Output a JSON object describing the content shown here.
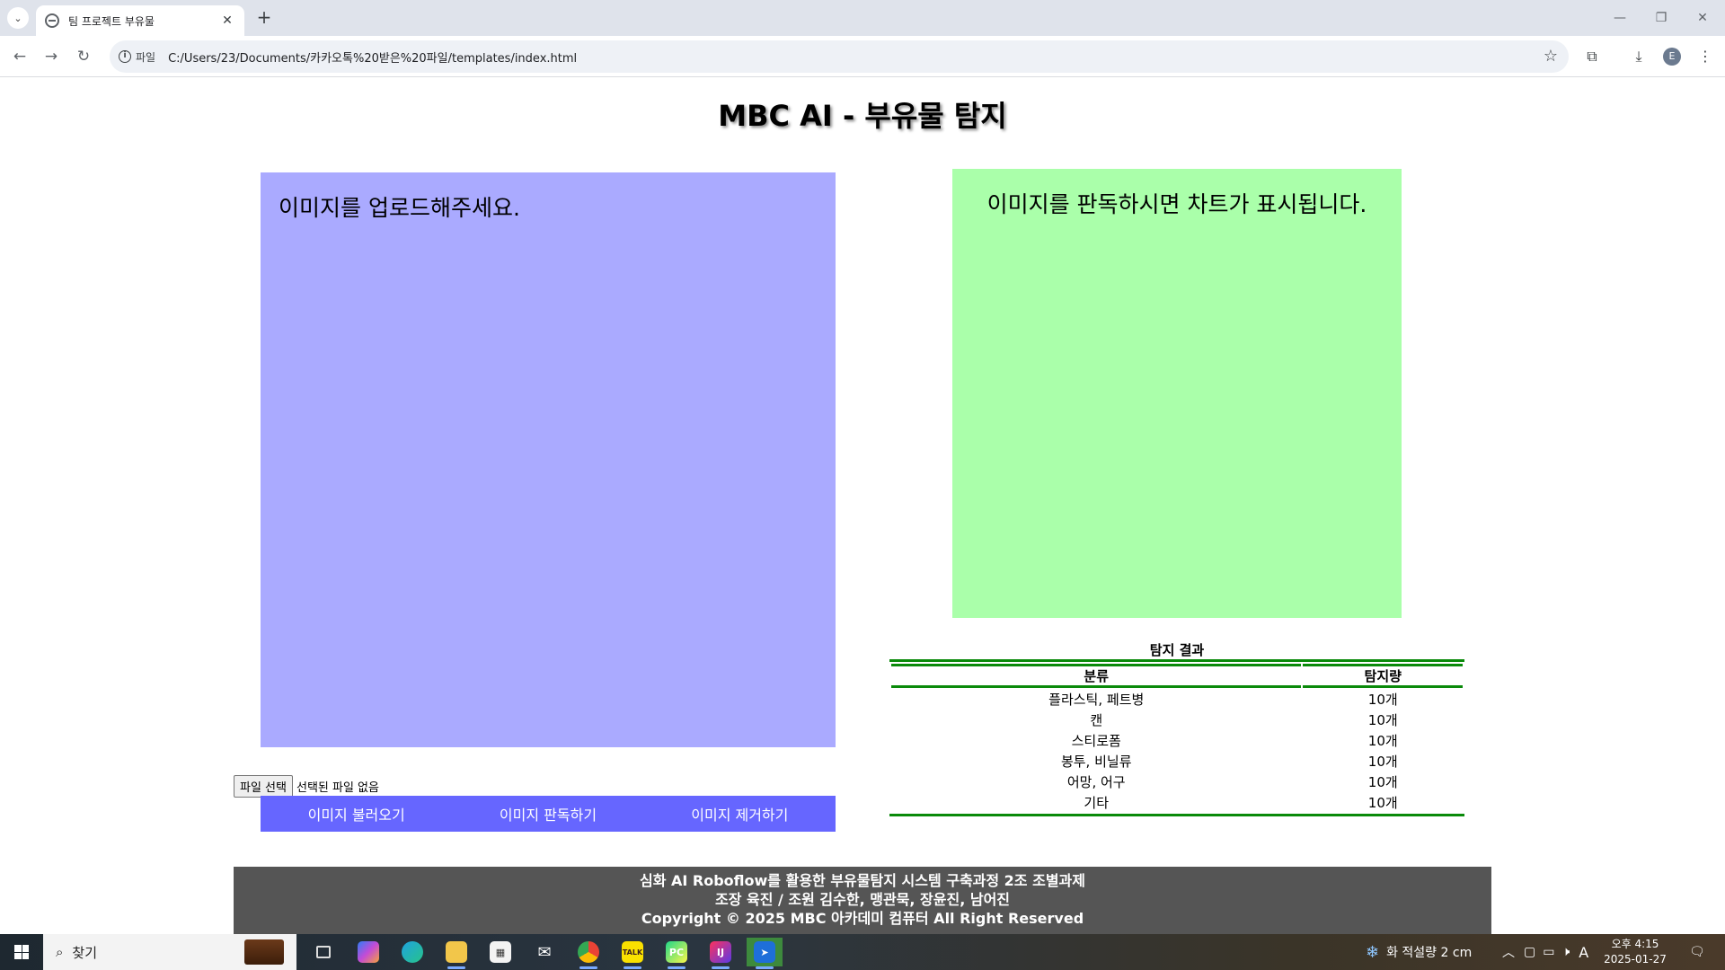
{
  "browser": {
    "tab_title": "팀 프로젝트 부유물",
    "address_chip": "파일",
    "url": "C:/Users/23/Documents/카카오톡%20받은%20파일/templates/index.html",
    "profile_initial": "E"
  },
  "page": {
    "title": "MBC AI - 부유물 탐지",
    "upload_placeholder": "이미지를 업로드해주세요.",
    "chart_placeholder": "이미지를 판독하시면 차트가 표시됩니다.",
    "file_input": {
      "button_label": "파일 선택",
      "status": "선택된 파일 없음"
    },
    "buttons": {
      "load": "이미지 불러오기",
      "analyze": "이미지 판독하기",
      "remove": "이미지 제거하기"
    },
    "results": {
      "caption": "탐지 결과",
      "headers": [
        "분류",
        "탐지량"
      ],
      "rows": [
        [
          "플라스틱, 페트병",
          "10개"
        ],
        [
          "캔",
          "10개"
        ],
        [
          "스티로폼",
          "10개"
        ],
        [
          "봉투, 비닐류",
          "10개"
        ],
        [
          "어망, 어구",
          "10개"
        ],
        [
          "기타",
          "10개"
        ]
      ]
    },
    "footer": {
      "line1": "심화 AI Roboflow를 활용한 부유물탐지 시스템 구축과정 2조 조별과제",
      "line2": "조장 육진 / 조원 김수한, 맹관묵, 장윤진, 남어진",
      "line3": "Copyright © 2025 MBC 아카데미 컴퓨터 All Right Reserved"
    },
    "colors": {
      "upload_bg": "#aaaaff",
      "chart_bg": "#aaffaa",
      "button_bar": "#6666ff",
      "table_border": "#0a8a0a",
      "footer_bg": "#555555"
    }
  },
  "taskbar": {
    "search_placeholder": "찾기",
    "weather": "화 적설량 2 cm",
    "ime": "A",
    "time": "오후 4:15",
    "date": "2025-01-27"
  }
}
